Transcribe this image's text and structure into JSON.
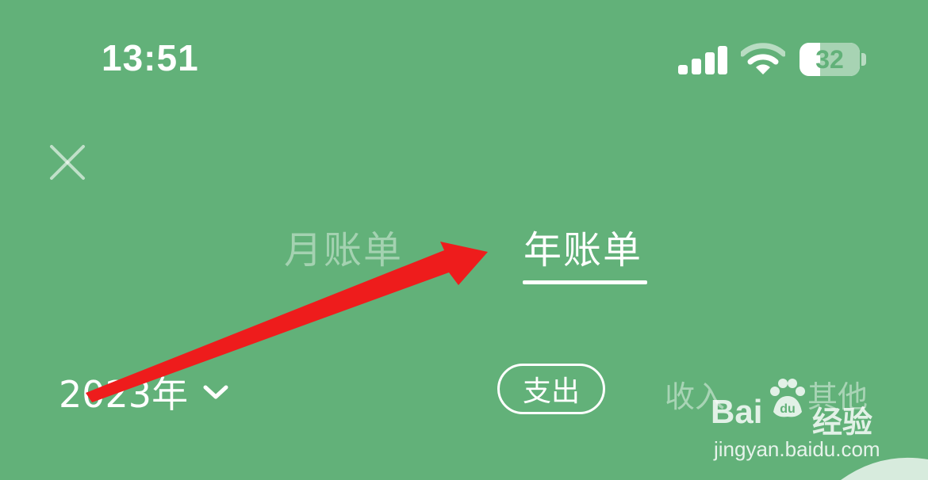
{
  "status_bar": {
    "time": "13:51",
    "battery_level": "32",
    "icons": [
      "signal-icon",
      "wifi-icon",
      "battery-icon"
    ]
  },
  "header": {
    "close_icon": "close-icon"
  },
  "tabs": [
    {
      "label": "月账单",
      "selected": false
    },
    {
      "label": "年账单",
      "selected": true
    }
  ],
  "year_selector": {
    "value": "2023年",
    "icon": "chevron-down-icon"
  },
  "filters": [
    {
      "label": "支出",
      "selected": true
    },
    {
      "label": "收入",
      "selected": false
    },
    {
      "label": "其他",
      "selected": false
    }
  ],
  "watermark": {
    "logo_text": "Bai",
    "logo_sub": "经验",
    "url": "jingyan.baidu.com"
  },
  "annotation": {
    "arrow_color": "#ee1c1c"
  },
  "colors": {
    "background": "#62b179",
    "foreground": "#ffffff"
  }
}
